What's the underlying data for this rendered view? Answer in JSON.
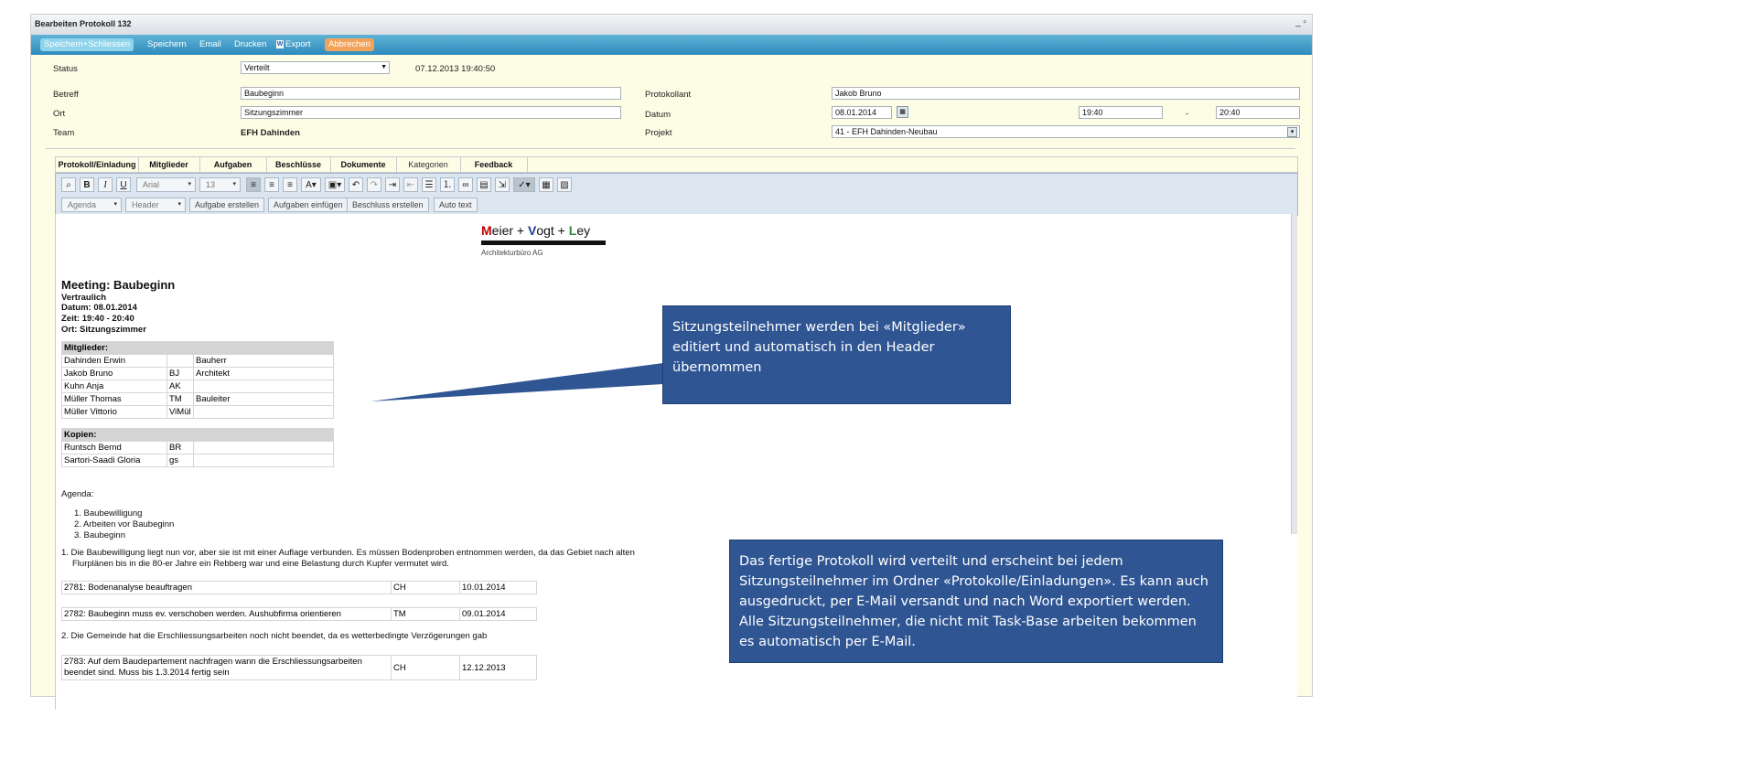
{
  "window": {
    "title": "Bearbeiten Protokoll 132",
    "controls": "_ ▫"
  },
  "toolbar": {
    "save_close": "Speichern+Schliessen",
    "save": "Speichern",
    "email": "Email",
    "print": "Drucken",
    "export": "Export",
    "cancel": "Abbrechen"
  },
  "form": {
    "status_label": "Status",
    "status_value": "Verteilt",
    "status_timestamp": "07.12.2013 19:40:50",
    "betreff_label": "Betreff",
    "betreff_value": "Baubeginn",
    "ort_label": "Ort",
    "ort_value": "Sitzungszimmer",
    "team_label": "Team",
    "team_value": "EFH Dahinden",
    "protokollant_label": "Protokollant",
    "protokollant_value": "Jakob Bruno",
    "datum_label": "Datum",
    "datum_value": "08.01.2014",
    "time_from": "19:40",
    "time_sep": "-",
    "time_to": "20:40",
    "projekt_label": "Projekt",
    "projekt_value": "41 - EFH Dahinden-Neubau"
  },
  "tabs": [
    "Protokoll/Einladung",
    "Mitglieder",
    "Aufgaben",
    "Beschlüsse",
    "Dokumente",
    "Kategorien",
    "Feedback"
  ],
  "editor": {
    "font": "Arial",
    "size": "13",
    "agenda_dd": "Agenda",
    "header_dd": "Header",
    "btn_create_task": "Aufgabe erstellen",
    "btn_insert_tasks": "Aufgaben einfügen",
    "btn_create_decision": "Beschluss erstellen",
    "btn_autotext": "Auto text"
  },
  "doc": {
    "logo_m": "M",
    "logo_eier": "eier + ",
    "logo_v": "V",
    "logo_ogt": "ogt + ",
    "logo_l": "L",
    "logo_ey": "ey",
    "logo_sub": "Architekturbüro AG",
    "meeting_title": "Meeting: Baubeginn",
    "confidential": "Vertraulich",
    "date_line": "Datum: 08.01.2014",
    "time_line": "Zeit: 19:40 - 20:40",
    "place_line": "Ort: Sitzungszimmer",
    "members_header": "Mitglieder:",
    "members": [
      {
        "name": "Dahinden Erwin",
        "abbr": "",
        "role": "Bauherr"
      },
      {
        "name": "Jakob Bruno",
        "abbr": "BJ",
        "role": "Architekt"
      },
      {
        "name": "Kuhn Anja",
        "abbr": "AK",
        "role": ""
      },
      {
        "name": "Müller Thomas",
        "abbr": "TM",
        "role": "Bauleiter"
      },
      {
        "name": "Müller Vittorio",
        "abbr": "ViMül",
        "role": ""
      }
    ],
    "copies_header": "Kopien:",
    "copies": [
      {
        "name": "Runtsch Bernd",
        "abbr": "BR",
        "role": ""
      },
      {
        "name": "Sartori-Saadi Gloria",
        "abbr": "gs",
        "role": ""
      }
    ],
    "agenda_label": "Agenda:",
    "agenda_items": [
      "1.  Baubewilligung",
      "2.  Arbeiten vor Baubeginn",
      "3.  Baubeginn"
    ],
    "item1_line1": "1. Die Baubewilligung liegt nun vor, aber sie ist mit einer Auflage verbunden. Es müssen Bodenproben entnommen werden, da das Gebiet nach alten",
    "item1_line2": "Flurplänen bis in die 80-er Jahre ein Rebberg war und eine Belastung durch Kupfer vermutet wird.",
    "tasks": [
      {
        "text": "2781: Bodenanalyse beauftragen",
        "who": "CH",
        "date": "10.01.2014"
      },
      {
        "text": "2782: Baubeginn muss ev. verschoben werden. Aushubfirma orientieren",
        "who": "TM",
        "date": "09.01.2014"
      }
    ],
    "item2": "2. Die Gemeinde hat die Erschliessungsarbeiten noch nicht beendet, da es wetterbedingte Verzögerungen gab",
    "task3_line1": "2783: Auf dem Baudepartement nachfragen wann die Erschliessungsarbeiten",
    "task3_line2": "beendet sind. Muss bis 1.3.2014 fertig sein",
    "task3_who": "CH",
    "task3_date": "12.12.2013"
  },
  "callouts": {
    "top": "Sitzungsteilnehmer werden bei «Mitglieder» editiert und automatisch in den Header übernommen",
    "bottom": "Das fertige Protokoll wird verteilt und erscheint bei jedem Sitzungsteilnehmer im Ordner «Protokolle/Einladungen». Es kann auch ausgedruckt, per E-Mail versandt und nach Word exportiert werden. Alle Sitzungsteilnehmer, die nicht mit Task-Base arbeiten bekommen es  automatisch per E-Mail."
  },
  "colors": {
    "callout_bg": "#2f5593",
    "toolbar": "#2f8cbd",
    "cancel": "#f2a35a",
    "logo_m": "#c00000",
    "logo_v": "#1f3a93",
    "logo_l": "#2e8b3a"
  }
}
